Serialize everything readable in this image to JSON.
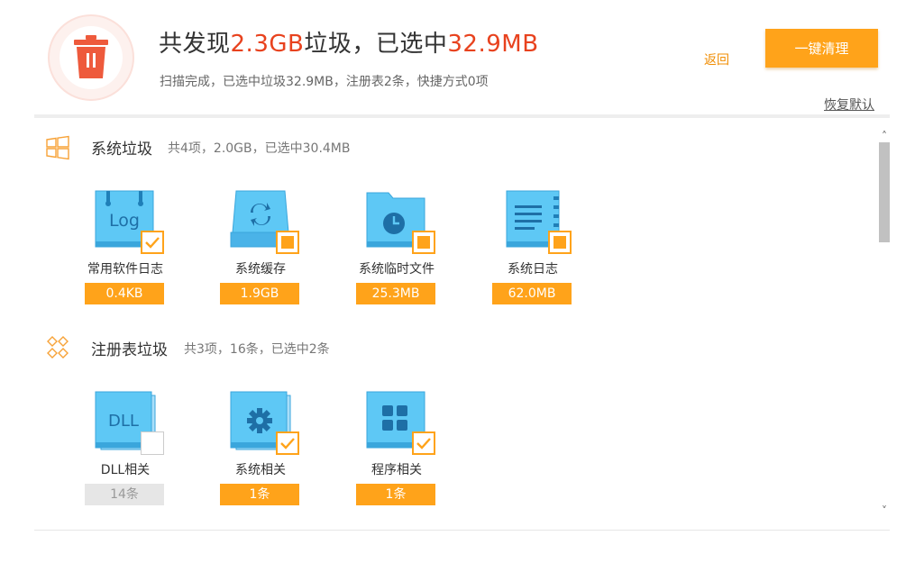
{
  "header": {
    "headline_prefix": "共发现",
    "headline_total": "2.3GB",
    "headline_middle": "垃圾，已选中",
    "headline_selected": "32.9MB",
    "subline": "扫描完成，已选中垃圾32.9MB，注册表2条，快捷方式0项",
    "back_label": "返回",
    "clean_label": "一键清理",
    "restore_label": "恢复默认",
    "accent_color": "#e8421e",
    "button_color": "#ffa31a"
  },
  "sections": {
    "system": {
      "icon": "windows-icon",
      "title": "系统垃圾",
      "summary": "共4项，2.0GB，已选中30.4MB",
      "items": [
        {
          "icon": "log-file-icon",
          "label": "常用软件日志",
          "size": "0.4KB",
          "state": "checked"
        },
        {
          "icon": "cache-drive-icon",
          "label": "系统缓存",
          "size": "1.9GB",
          "state": "partial"
        },
        {
          "icon": "temp-folder-icon",
          "label": "系统临时文件",
          "size": "25.3MB",
          "state": "partial"
        },
        {
          "icon": "system-log-icon",
          "label": "系统日志",
          "size": "62.0MB",
          "state": "partial"
        }
      ]
    },
    "registry": {
      "icon": "registry-grid-icon",
      "title": "注册表垃圾",
      "summary": "共3项，16条，已选中2条",
      "items": [
        {
          "icon": "dll-file-icon",
          "label": "DLL相关",
          "size": "14条",
          "state": "unchecked"
        },
        {
          "icon": "system-settings-icon",
          "label": "系统相关",
          "size": "1条",
          "state": "checked"
        },
        {
          "icon": "program-apps-icon",
          "label": "程序相关",
          "size": "1条",
          "state": "checked"
        }
      ]
    }
  },
  "scrollbar": {
    "up_glyph": "˄",
    "down_glyph": "˅"
  }
}
